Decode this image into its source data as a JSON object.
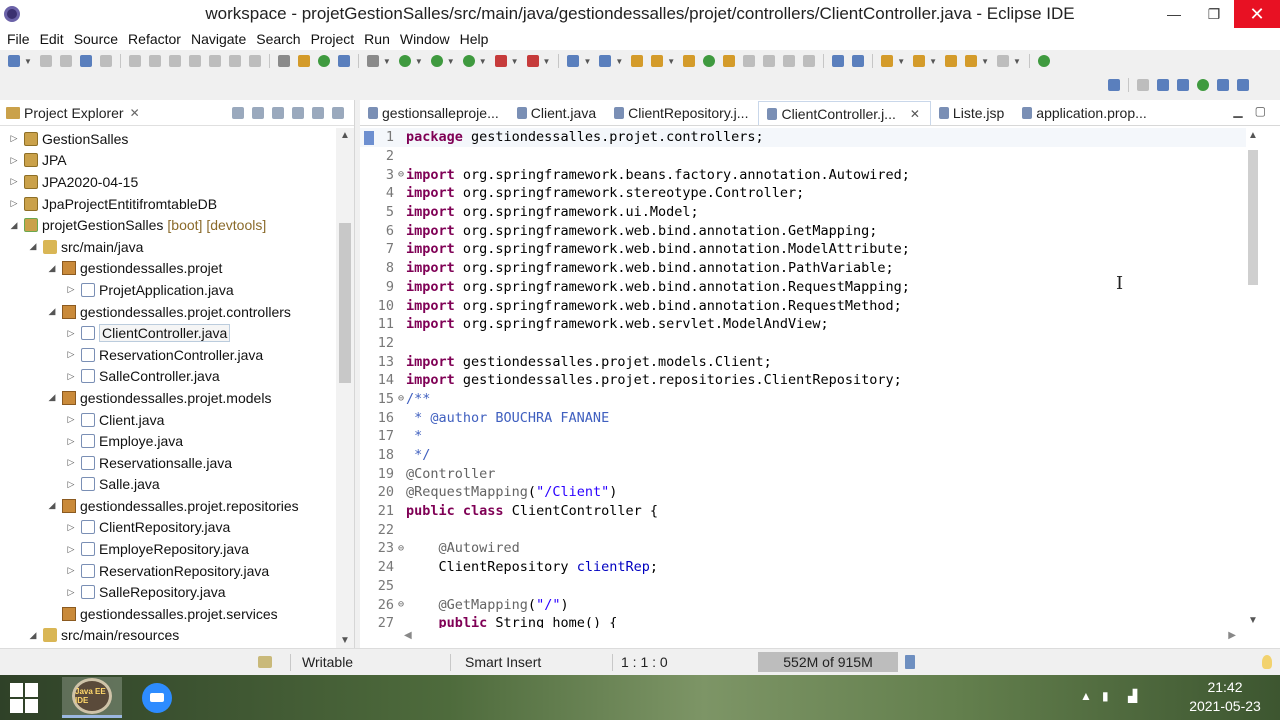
{
  "window": {
    "title": "workspace - projetGestionSalles/src/main/java/gestiondessalles/projet/controllers/ClientController.java - Eclipse IDE",
    "minimize_glyph": "—",
    "maximize_glyph": "❐",
    "close_glyph": "✕"
  },
  "menu": [
    "File",
    "Edit",
    "Source",
    "Refactor",
    "Navigate",
    "Search",
    "Project",
    "Run",
    "Window",
    "Help"
  ],
  "explorer": {
    "title": "Project Explorer",
    "close_glyph": "✕",
    "tree": [
      {
        "label": "GestionSalles",
        "depth": 0,
        "expanded": false,
        "icon": "project-icon"
      },
      {
        "label": "JPA",
        "depth": 0,
        "expanded": false,
        "icon": "project-icon"
      },
      {
        "label": "JPA2020-04-15",
        "depth": 0,
        "expanded": false,
        "icon": "project-icon"
      },
      {
        "label": "JpaProjectEntitifromtableDB",
        "depth": 0,
        "expanded": false,
        "icon": "project-icon"
      },
      {
        "label": "projetGestionSalles",
        "decoration": "[boot] [devtools]",
        "depth": 0,
        "expanded": true,
        "icon": "boot-project-icon"
      },
      {
        "label": "src/main/java",
        "depth": 1,
        "expanded": true,
        "icon": "source-folder-icon"
      },
      {
        "label": "gestiondessalles.projet",
        "depth": 2,
        "expanded": true,
        "icon": "package-icon"
      },
      {
        "label": "ProjetApplication.java",
        "depth": 3,
        "expanded": false,
        "icon": "java-file-icon"
      },
      {
        "label": "gestiondessalles.projet.controllers",
        "depth": 2,
        "expanded": true,
        "icon": "package-icon"
      },
      {
        "label": "ClientController.java",
        "depth": 3,
        "expanded": false,
        "icon": "java-file-icon",
        "selected": true
      },
      {
        "label": "ReservationController.java",
        "depth": 3,
        "expanded": false,
        "icon": "java-file-icon"
      },
      {
        "label": "SalleController.java",
        "depth": 3,
        "expanded": false,
        "icon": "java-file-icon"
      },
      {
        "label": "gestiondessalles.projet.models",
        "depth": 2,
        "expanded": true,
        "icon": "package-icon"
      },
      {
        "label": "Client.java",
        "depth": 3,
        "expanded": false,
        "icon": "java-file-icon"
      },
      {
        "label": "Employe.java",
        "depth": 3,
        "expanded": false,
        "icon": "java-file-icon"
      },
      {
        "label": "Reservationsalle.java",
        "depth": 3,
        "expanded": false,
        "icon": "java-file-icon"
      },
      {
        "label": "Salle.java",
        "depth": 3,
        "expanded": false,
        "icon": "java-file-icon"
      },
      {
        "label": "gestiondessalles.projet.repositories",
        "depth": 2,
        "expanded": true,
        "icon": "package-icon"
      },
      {
        "label": "ClientRepository.java",
        "depth": 3,
        "expanded": false,
        "icon": "interface-file-icon"
      },
      {
        "label": "EmployeRepository.java",
        "depth": 3,
        "expanded": false,
        "icon": "interface-file-icon"
      },
      {
        "label": "ReservationRepository.java",
        "depth": 3,
        "expanded": false,
        "icon": "interface-file-icon"
      },
      {
        "label": "SalleRepository.java",
        "depth": 3,
        "expanded": false,
        "icon": "interface-file-icon"
      },
      {
        "label": "gestiondessalles.projet.services",
        "depth": 2,
        "expanded": null,
        "icon": "package-icon"
      },
      {
        "label": "src/main/resources",
        "depth": 1,
        "expanded": true,
        "icon": "source-folder-icon"
      }
    ]
  },
  "editor": {
    "tabs": [
      {
        "label": "gestionsalleproje...",
        "icon": "maven-pom-icon",
        "active": false
      },
      {
        "label": "Client.java",
        "icon": "java-file-icon",
        "active": false
      },
      {
        "label": "ClientRepository.j...",
        "icon": "java-file-icon",
        "active": false
      },
      {
        "label": "ClientController.j...",
        "icon": "java-file-icon",
        "active": true
      },
      {
        "label": "Liste.jsp",
        "icon": "jsp-file-icon",
        "active": false
      },
      {
        "label": "application.prop...",
        "icon": "properties-file-icon",
        "active": false
      }
    ],
    "tab_close_glyph": "✕",
    "lines": [
      {
        "n": "1",
        "fold": "",
        "tokens": [
          {
            "t": "kw",
            "v": "package"
          },
          {
            "t": "",
            "v": " gestiondessalles.projet.controllers;"
          }
        ]
      },
      {
        "n": "2",
        "fold": "",
        "tokens": []
      },
      {
        "n": "3",
        "fold": "⊖",
        "tokens": [
          {
            "t": "kw",
            "v": "import"
          },
          {
            "t": "",
            "v": " org.springframework.beans.factory.annotation.Autowired;"
          }
        ]
      },
      {
        "n": "4",
        "fold": "",
        "tokens": [
          {
            "t": "kw",
            "v": "import"
          },
          {
            "t": "",
            "v": " org.springframework.stereotype.Controller;"
          }
        ]
      },
      {
        "n": "5",
        "fold": "",
        "tokens": [
          {
            "t": "kw",
            "v": "import"
          },
          {
            "t": "",
            "v": " org.springframework.ui.Model;"
          }
        ]
      },
      {
        "n": "6",
        "fold": "",
        "tokens": [
          {
            "t": "kw",
            "v": "import"
          },
          {
            "t": "",
            "v": " org.springframework.web.bind.annotation.GetMapping;"
          }
        ]
      },
      {
        "n": "7",
        "fold": "",
        "tokens": [
          {
            "t": "kw",
            "v": "import"
          },
          {
            "t": "",
            "v": " org.springframework.web.bind.annotation.ModelAttribute;"
          }
        ]
      },
      {
        "n": "8",
        "fold": "",
        "tokens": [
          {
            "t": "kw",
            "v": "import"
          },
          {
            "t": "",
            "v": " org.springframework.web.bind.annotation.PathVariable;"
          }
        ]
      },
      {
        "n": "9",
        "fold": "",
        "tokens": [
          {
            "t": "kw",
            "v": "import"
          },
          {
            "t": "",
            "v": " org.springframework.web.bind.annotation.RequestMapping;"
          }
        ]
      },
      {
        "n": "10",
        "fold": "",
        "tokens": [
          {
            "t": "kw",
            "v": "import"
          },
          {
            "t": "",
            "v": " org.springframework.web.bind.annotation.RequestMethod;"
          }
        ]
      },
      {
        "n": "11",
        "fold": "",
        "tokens": [
          {
            "t": "kw",
            "v": "import"
          },
          {
            "t": "",
            "v": " org.springframework.web.servlet.ModelAndView;"
          }
        ]
      },
      {
        "n": "12",
        "fold": "",
        "tokens": []
      },
      {
        "n": "13",
        "fold": "",
        "tokens": [
          {
            "t": "kw",
            "v": "import"
          },
          {
            "t": "",
            "v": " gestiondessalles.projet.models.Client;"
          }
        ]
      },
      {
        "n": "14",
        "fold": "",
        "tokens": [
          {
            "t": "kw",
            "v": "import"
          },
          {
            "t": "",
            "v": " gestiondessalles.projet.repositories.ClientRepository;"
          }
        ]
      },
      {
        "n": "15",
        "fold": "⊖",
        "tokens": [
          {
            "t": "cmt",
            "v": "/**"
          }
        ]
      },
      {
        "n": "16",
        "fold": "",
        "tokens": [
          {
            "t": "cmt",
            "v": " * @author BOUCHRA FANANE"
          }
        ]
      },
      {
        "n": "17",
        "fold": "",
        "tokens": [
          {
            "t": "cmt",
            "v": " *"
          }
        ]
      },
      {
        "n": "18",
        "fold": "",
        "tokens": [
          {
            "t": "cmt",
            "v": " */"
          }
        ]
      },
      {
        "n": "19",
        "fold": "",
        "tokens": [
          {
            "t": "ann",
            "v": "@Controller"
          }
        ]
      },
      {
        "n": "20",
        "fold": "",
        "tokens": [
          {
            "t": "ann",
            "v": "@RequestMapping"
          },
          {
            "t": "",
            "v": "("
          },
          {
            "t": "str",
            "v": "\"/Client\""
          },
          {
            "t": "",
            "v": ")"
          }
        ]
      },
      {
        "n": "21",
        "fold": "",
        "tokens": [
          {
            "t": "kw",
            "v": "public"
          },
          {
            "t": "",
            "v": " "
          },
          {
            "t": "kw",
            "v": "class"
          },
          {
            "t": "",
            "v": " ClientController {"
          }
        ]
      },
      {
        "n": "22",
        "fold": "",
        "tokens": []
      },
      {
        "n": "23",
        "fold": "⊖",
        "tokens": [
          {
            "t": "",
            "v": "    "
          },
          {
            "t": "ann",
            "v": "@Autowired"
          }
        ]
      },
      {
        "n": "24",
        "fold": "",
        "tokens": [
          {
            "t": "",
            "v": "    ClientRepository "
          },
          {
            "t": "field",
            "v": "clientRep"
          },
          {
            "t": "",
            "v": ";"
          }
        ]
      },
      {
        "n": "25",
        "fold": "",
        "tokens": []
      },
      {
        "n": "26",
        "fold": "⊖",
        "tokens": [
          {
            "t": "",
            "v": "    "
          },
          {
            "t": "ann",
            "v": "@GetMapping"
          },
          {
            "t": "",
            "v": "("
          },
          {
            "t": "str",
            "v": "\"/\""
          },
          {
            "t": "",
            "v": ")"
          }
        ]
      },
      {
        "n": "27",
        "fold": "",
        "tokens": [
          {
            "t": "",
            "v": "    "
          },
          {
            "t": "kw",
            "v": "public"
          },
          {
            "t": "",
            "v": " String home() {"
          }
        ]
      }
    ]
  },
  "status": {
    "writable": "Writable",
    "insert_mode": "Smart Insert",
    "position": "1 : 1 : 0",
    "heap": "552M of 915M"
  },
  "taskbar": {
    "eclipse_label": "Java EE IDE",
    "time": "21:42",
    "date": "2021-05-23"
  },
  "colors": {
    "keyword": "#7f0055",
    "annotation": "#646464",
    "string": "#2a00ff",
    "comment": "#3f5fbf",
    "field": "#0000c0"
  }
}
